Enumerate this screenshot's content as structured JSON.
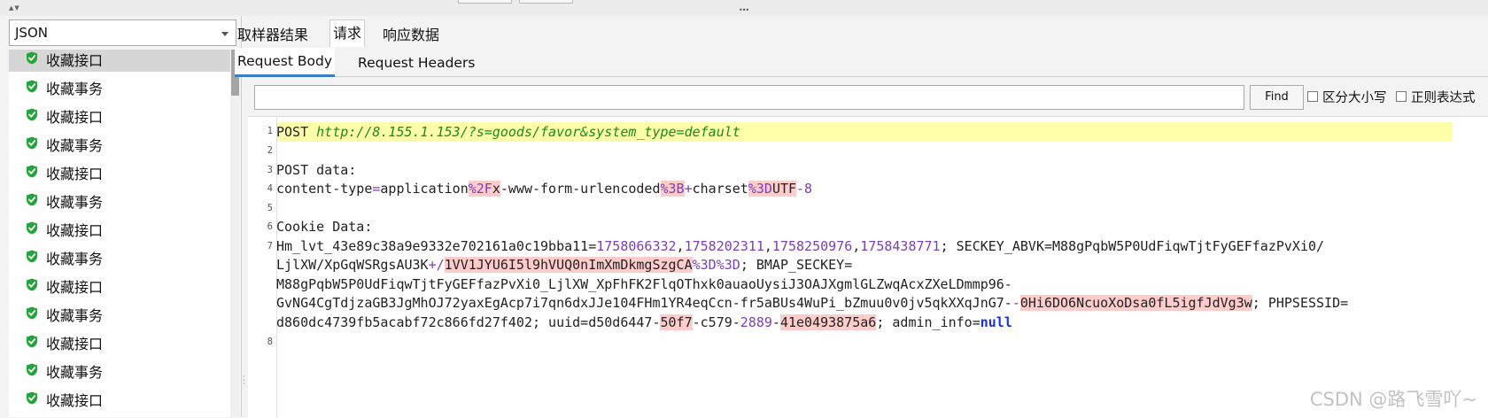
{
  "left": {
    "renderer": "JSON",
    "items": [
      {
        "label": "收藏接口"
      },
      {
        "label": "收藏事务"
      },
      {
        "label": "收藏接口"
      },
      {
        "label": "收藏事务"
      },
      {
        "label": "收藏接口"
      },
      {
        "label": "收藏事务"
      },
      {
        "label": "收藏接口"
      },
      {
        "label": "收藏事务"
      },
      {
        "label": "收藏接口"
      },
      {
        "label": "收藏事务"
      },
      {
        "label": "收藏接口"
      },
      {
        "label": "收藏事务"
      },
      {
        "label": "收藏接口"
      }
    ]
  },
  "tabs": {
    "sampler_result": "取样器结果",
    "request": "请求",
    "response_data": "响应数据"
  },
  "subtabs": {
    "request_body": "Request Body",
    "request_headers": "Request Headers"
  },
  "find": {
    "value": "",
    "button": "Find",
    "case_sensitive": "区分大小写",
    "regex": "正则表达式"
  },
  "editor": {
    "line_numbers": [
      "1",
      "2",
      "3",
      "4",
      "5",
      "6",
      "7",
      "",
      "",
      "",
      "",
      "8"
    ],
    "line1": {
      "method": "POST ",
      "url": "http://8.155.1.153/?s=goods/favor&system_type=default"
    },
    "line3": "POST data:",
    "line4": {
      "a": "content-type",
      "eq1": "=",
      "b": "application",
      "c": "%2F",
      "d": "x",
      "e": "-www-form-urlencoded",
      "f": "%3B",
      "g": "+",
      "h": "charset",
      "i": "%3D",
      "j": "UTF",
      "k": "-8"
    },
    "line6": "Cookie Data:",
    "line7a": {
      "a": "Hm_lvt_43e89c38a9e9332e702161a0c19bba11=",
      "n1": "1758066332",
      "c1": ",",
      "n2": "1758202311",
      "c2": ",",
      "n3": "1758250976",
      "c3": ",",
      "n4": "1758438771",
      "b": "; SECKEY_ABVK=M88gPqbW5P0UdFiqwTjtFyGEFfazPvXi0/"
    },
    "line7b": {
      "a": "LjlXW/XpGqWSRgsAU3K",
      "b": "+/",
      "c": "1VV1JYU6I5l9hVUQ0nImXmDkmgSzgCA",
      "d": "%3D%3D",
      "e": "; BMAP_SECKEY="
    },
    "line7c": "M88gPqbW5P0UdFiqwTjtFyGEFfazPvXi0_LjlXW_XpFhFK2FlqOThxk0auaoUysiJ3OAJXgmlGLZwqAcxZXeLDmmp96-",
    "line7d": {
      "a": "GvNG4CgTdjzaGB3JgMhOJ72yaxEgAcp7i7qn6dxJJe104FHm1YR4eqCcn-fr5aBUs4WuPi_bZmuu0v0jv5qkXXqJnG7-",
      "b": "-",
      "c": "0Hi6DO6NcuoXoDsa0fL5igfJdVg3w",
      "d": "; PHPSESSID="
    },
    "line7e": {
      "a": "d860dc4739fb5acabf72c866fd27f402; uuid=d50d6447-",
      "b": "50f7",
      "c": "-c579-",
      "d": "2889",
      "e": "-",
      "f": "41e0493875a6",
      "g": "; admin_info=",
      "h": "null"
    }
  },
  "watermark": "CSDN @路飞雪吖~"
}
